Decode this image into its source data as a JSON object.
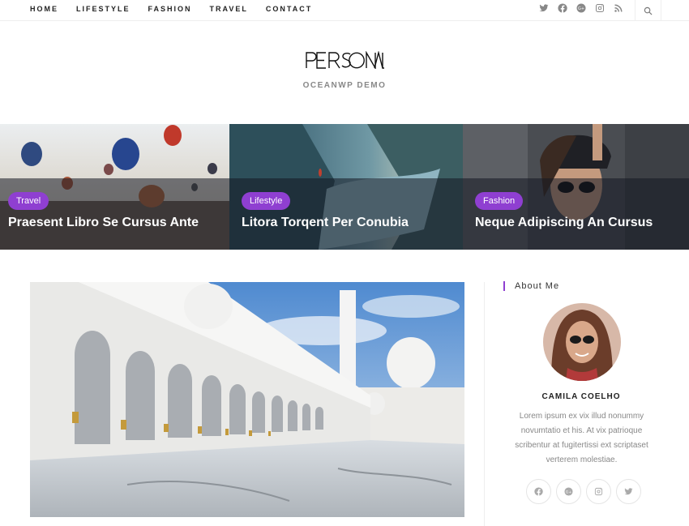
{
  "nav": {
    "items": [
      "HOME",
      "LIFESTYLE",
      "FASHION",
      "TRAVEL",
      "CONTACT"
    ]
  },
  "header_social": [
    "twitter-icon",
    "facebook-icon",
    "google-plus-icon",
    "instagram-icon",
    "rss-icon"
  ],
  "site": {
    "logo": "PERSONAL",
    "tagline": "OCEANWP DEMO"
  },
  "featured": [
    {
      "category": "Travel",
      "title": "Praesent Libro Se Cursus Ante"
    },
    {
      "category": "Lifestyle",
      "title": "Litora Torqent Per Conubia"
    },
    {
      "category": "Fashion",
      "title": "Neque Adipiscing An Cursus"
    }
  ],
  "sidebar": {
    "widget_title": "About Me",
    "name": "CAMILA COELHO",
    "bio": "Lorem ipsum ex vix illud nonummy novumtatio et his. At vix patrioque scribentur at fugitertissi ext scriptaset verterem molestiae.",
    "social": [
      "facebook-icon",
      "google-plus-icon",
      "instagram-icon",
      "twitter-icon"
    ]
  },
  "colors": {
    "accent": "#8f3fd1",
    "overlay": "#141822"
  }
}
